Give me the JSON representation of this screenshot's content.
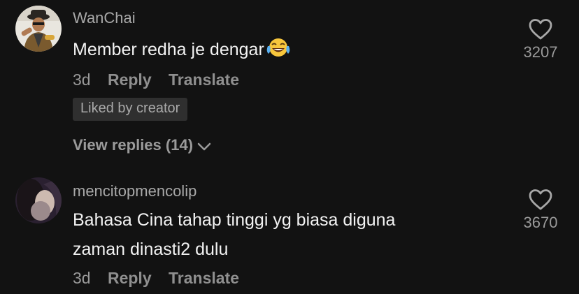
{
  "comments": [
    {
      "username": "WanChai",
      "text": "Member redha je dengar",
      "emoji": "tears-of-joy-emoji",
      "time": "3d",
      "reply_label": "Reply",
      "translate_label": "Translate",
      "badge": "Liked by creator",
      "view_replies": "View replies (14)",
      "likes": "3207"
    },
    {
      "username": "mencitopmencolip",
      "text_line1": "Bahasa Cina tahap tinggi yg biasa diguna",
      "text_line2": "zaman dinasti2 dulu",
      "time": "3d",
      "reply_label": "Reply",
      "translate_label": "Translate",
      "likes": "3670"
    }
  ],
  "icons": {
    "like": "heart-outline-icon",
    "expand": "chevron-down-icon"
  },
  "colors": {
    "background": "#121212",
    "username": "#a8a8a8",
    "text": "#f2f2f2",
    "meta": "#9a9a9a",
    "badge_bg": "#2f2f2f"
  }
}
